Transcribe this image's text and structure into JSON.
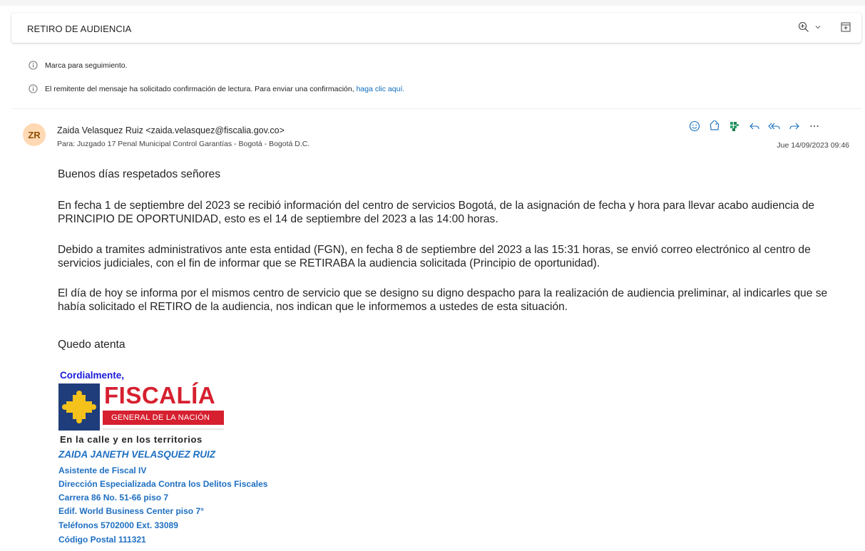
{
  "email": {
    "subject": "RETIRO DE AUDIENCIA",
    "notices": {
      "follow_up": "Marca para seguimiento.",
      "read_receipt": "El remitente del mensaje ha solicitado confirmación de lectura. Para enviar una confirmación,",
      "read_receipt_link": "haga clic aquí."
    },
    "sender": {
      "initials": "ZR",
      "from": "Zaida Velasquez Ruiz <zaida.velasquez@fiscalia.gov.co>",
      "to": "Para:  Juzgado 17 Penal Municipal Control Garantías - Bogotá - Bogotá D.C.",
      "date": "Jue 14/09/2023 09:46"
    },
    "body": {
      "greeting": "Buenos días respetados señores",
      "p1": "En fecha 1 de septiembre del 2023 se recibió información del centro de servicios Bogotá, de la asignación de fecha y hora para llevar acabo audiencia de PRINCIPIO DE OPORTUNIDAD, esto es el 14 de septiembre del 2023 a las 14:00 horas.",
      "p2": "Debido a tramites administrativos ante esta entidad (FGN), en fecha 8 de septiembre del 2023 a las 15:31 horas, se envió correo electrónico al centro de servicios judiciales, con el fin de informar que se RETIRABA la audiencia solicitada (Principio de oportunidad).",
      "p3": "El día de hoy se informa por el mismos centro de servicio que se designo su digno despacho para la realización de audiencia preliminar, al indicarles que se había solicitado el RETIRO de la audiencia, nos indican que le informemos a ustedes de esta situación.",
      "closing": "Quedo atenta"
    },
    "signature": {
      "cordial": "Cordialmente,",
      "logo_main": "FISCALÍA",
      "logo_sub": "GENERAL DE LA NACIÓN",
      "tagline": "En la calle y en los territorios",
      "name": "ZAIDA JANETH VELASQUEZ RUIZ",
      "lines": [
        "Asistente de Fiscal IV",
        "Dirección Especializada Contra los Delitos Fiscales",
        "Carrera 86 No. 51-66 piso 7",
        "Edif. World Business Center piso 7°",
        "Teléfonos 5702000 Ext. 33089",
        "Código Postal 111321"
      ]
    }
  },
  "colors": {
    "link": "#0f6cbd",
    "icon": "#0f6cbd",
    "signature_blue": "#1e6fc2",
    "logo_red": "#d6202f",
    "logo_navy": "#1f3d7a",
    "logo_yellow": "#f4c21b"
  },
  "icons": [
    "zoom-icon",
    "chevron-down-icon",
    "expand-icon",
    "info-icon",
    "emoji-icon",
    "tag-icon",
    "apps-icon",
    "reply-icon",
    "reply-all-icon",
    "forward-icon",
    "more-icon"
  ]
}
